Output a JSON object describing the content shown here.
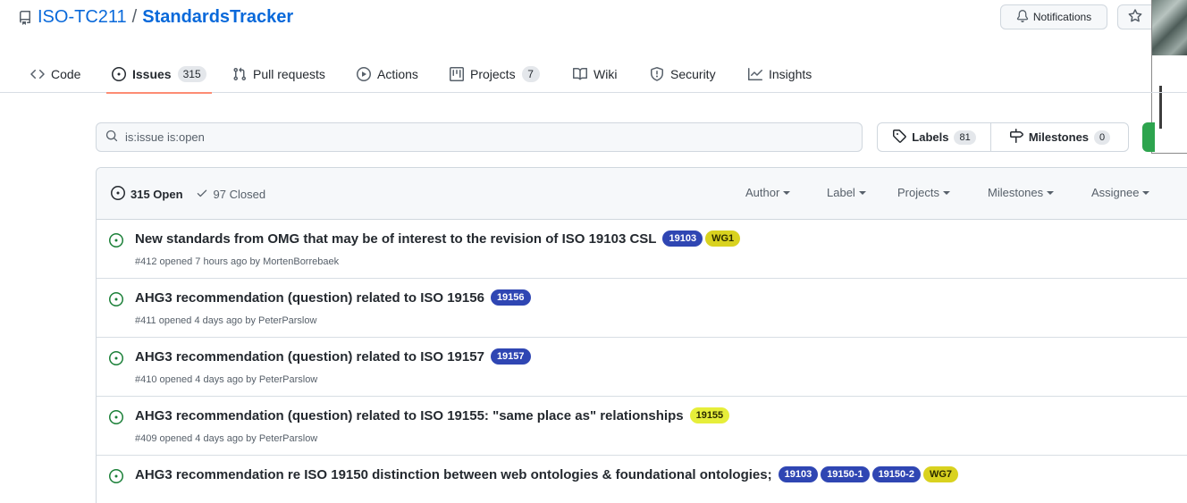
{
  "repo": {
    "owner": "ISO-TC211",
    "separator": "/",
    "name": "StandardsTracker"
  },
  "header_buttons": {
    "notifications_label": "Notifications"
  },
  "tabs": [
    {
      "label": "Code",
      "icon": "code-icon",
      "count": null
    },
    {
      "label": "Issues",
      "icon": "issue-opened-icon",
      "count": "315",
      "selected": true
    },
    {
      "label": "Pull requests",
      "icon": "git-pull-request-icon",
      "count": null
    },
    {
      "label": "Actions",
      "icon": "play-icon",
      "count": null
    },
    {
      "label": "Projects",
      "icon": "project-icon",
      "count": "7"
    },
    {
      "label": "Wiki",
      "icon": "book-icon",
      "count": null
    },
    {
      "label": "Security",
      "icon": "shield-icon",
      "count": null
    },
    {
      "label": "Insights",
      "icon": "graph-icon",
      "count": null
    }
  ],
  "filter": {
    "value": "is:issue is:open"
  },
  "labels_button": {
    "label": "Labels",
    "count": "81"
  },
  "milestones_button": {
    "label": "Milestones",
    "count": "0"
  },
  "list_header": {
    "open_label": "315 Open",
    "closed_label": "97 Closed",
    "filters": [
      "Author",
      "Label",
      "Projects",
      "Milestones",
      "Assignee"
    ]
  },
  "colors": {
    "label_blue": "#2f46b3",
    "label_yellow": "#d4d41c",
    "label_yellow_light": "#e3ec3c",
    "open_green": "#1a7f37"
  },
  "issues": [
    {
      "title": "New standards from OMG that may be of interest to the revision of ISO 19103 CSL",
      "labels": [
        {
          "text": "19103",
          "color": "#2f46b3",
          "fg": "#ffffff"
        },
        {
          "text": "WG1",
          "color": "#d9d21f",
          "fg": "#2b2b00"
        }
      ],
      "meta": "#412 opened 7 hours ago by MortenBorrebaek"
    },
    {
      "title": "AHG3 recommendation (question) related to ISO 19156",
      "labels": [
        {
          "text": "19156",
          "color": "#2f46b3",
          "fg": "#ffffff"
        }
      ],
      "meta": "#411 opened 4 days ago by PeterParslow"
    },
    {
      "title": "AHG3 recommendation (question) related to ISO 19157",
      "labels": [
        {
          "text": "19157",
          "color": "#2f46b3",
          "fg": "#ffffff"
        }
      ],
      "meta": "#410 opened 4 days ago by PeterParslow"
    },
    {
      "title": "AHG3 recommendation (question) related to ISO 19155: \"same place as\" relationships",
      "labels": [
        {
          "text": "19155",
          "color": "#e6ee3a",
          "fg": "#2b2b00"
        }
      ],
      "meta": "#409 opened 4 days ago by PeterParslow"
    },
    {
      "title": "AHG3 recommendation re ISO 19150 distinction between web ontologies & foundational ontologies;",
      "labels": [
        {
          "text": "19103",
          "color": "#2f46b3",
          "fg": "#ffffff"
        },
        {
          "text": "19150-1",
          "color": "#2f46b3",
          "fg": "#ffffff"
        },
        {
          "text": "19150-2",
          "color": "#2f46b3",
          "fg": "#ffffff"
        },
        {
          "text": "WG7",
          "color": "#d9d21f",
          "fg": "#2b2b00"
        }
      ],
      "meta": ""
    }
  ]
}
